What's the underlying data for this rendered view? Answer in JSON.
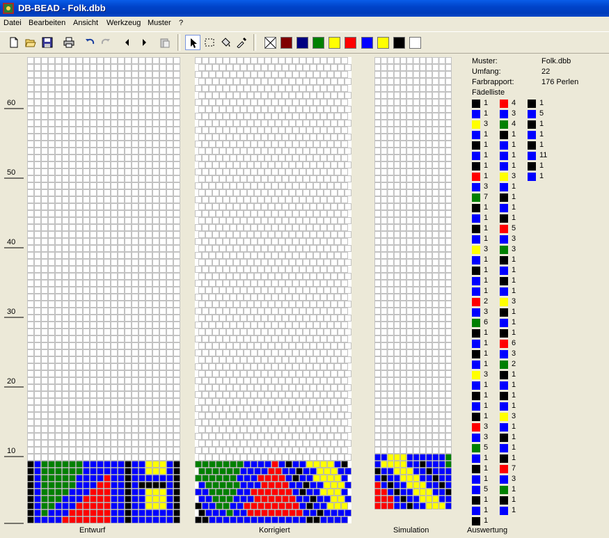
{
  "window": {
    "title": "DB-BEAD - Folk.dbb"
  },
  "menu": [
    "Datei",
    "Bearbeiten",
    "Ansicht",
    "Werkzeug",
    "Muster",
    "?"
  ],
  "palette": [
    "#800000",
    "#000080",
    "#008000",
    "#ffff00",
    "#ff0000",
    "#0000ff",
    "#ffff00",
    "#000000",
    "#ffffff"
  ],
  "ruler_labels": [
    "60",
    "50",
    "40",
    "30",
    "20",
    "10"
  ],
  "panels": {
    "entwurf": "Entwurf",
    "korrigiert": "Korrigiert",
    "simulation": "Simulation",
    "auswertung": "Auswertung"
  },
  "info": {
    "muster_label": "Muster:",
    "muster_value": "Folk.dbb",
    "umfang_label": "Umfang:",
    "umfang_value": "22",
    "farbrapport_label": "Farbrapport:",
    "farbrapport_value": "176 Perlen",
    "faedelliste_label": "Fädelliste"
  },
  "color_codes": {
    "K": "#000000",
    "B": "#0000ff",
    "Y": "#ffff00",
    "R": "#ff0000",
    "G": "#008000"
  },
  "faedelliste": [
    [
      [
        "K",
        1
      ],
      [
        "B",
        1
      ],
      [
        "Y",
        3
      ],
      [
        "B",
        1
      ],
      [
        "K",
        1
      ],
      [
        "B",
        1
      ],
      [
        "K",
        1
      ],
      [
        "R",
        1
      ],
      [
        "B",
        3
      ],
      [
        "G",
        7
      ],
      [
        "K",
        1
      ],
      [
        "B",
        1
      ],
      [
        "K",
        1
      ],
      [
        "B",
        1
      ],
      [
        "Y",
        3
      ],
      [
        "B",
        1
      ],
      [
        "K",
        1
      ],
      [
        "B",
        1
      ],
      [
        "B",
        1
      ],
      [
        "R",
        2
      ],
      [
        "B",
        3
      ],
      [
        "G",
        6
      ],
      [
        "K",
        1
      ],
      [
        "B",
        1
      ],
      [
        "K",
        1
      ],
      [
        "B",
        1
      ],
      [
        "Y",
        3
      ],
      [
        "B",
        1
      ],
      [
        "K",
        1
      ],
      [
        "B",
        1
      ],
      [
        "K",
        1
      ],
      [
        "R",
        3
      ],
      [
        "B",
        3
      ],
      [
        "G",
        5
      ],
      [
        "B",
        1
      ],
      [
        "K",
        1
      ],
      [
        "B",
        1
      ],
      [
        "B",
        5
      ],
      [
        "K",
        1
      ],
      [
        "B",
        1
      ],
      [
        "K",
        1
      ]
    ],
    [
      [
        "R",
        4
      ],
      [
        "B",
        3
      ],
      [
        "G",
        4
      ],
      [
        "K",
        1
      ],
      [
        "B",
        1
      ],
      [
        "B",
        1
      ],
      [
        "B",
        1
      ],
      [
        "Y",
        3
      ],
      [
        "B",
        1
      ],
      [
        "K",
        1
      ],
      [
        "B",
        1
      ],
      [
        "K",
        1
      ],
      [
        "R",
        5
      ],
      [
        "B",
        3
      ],
      [
        "G",
        3
      ],
      [
        "K",
        1
      ],
      [
        "B",
        1
      ],
      [
        "K",
        1
      ],
      [
        "B",
        1
      ],
      [
        "Y",
        3
      ],
      [
        "K",
        1
      ],
      [
        "B",
        1
      ],
      [
        "K",
        1
      ],
      [
        "R",
        6
      ],
      [
        "B",
        3
      ],
      [
        "G",
        2
      ],
      [
        "K",
        1
      ],
      [
        "B",
        1
      ],
      [
        "K",
        1
      ],
      [
        "B",
        1
      ],
      [
        "Y",
        3
      ],
      [
        "B",
        1
      ],
      [
        "K",
        1
      ],
      [
        "B",
        1
      ],
      [
        "K",
        1
      ],
      [
        "R",
        7
      ],
      [
        "B",
        3
      ],
      [
        "G",
        1
      ],
      [
        "K",
        1
      ],
      [
        "B",
        1
      ]
    ],
    [
      [
        "K",
        1
      ],
      [
        "B",
        5
      ],
      [
        "K",
        1
      ],
      [
        "B",
        1
      ],
      [
        "K",
        1
      ],
      [
        "B",
        11
      ],
      [
        "K",
        1
      ],
      [
        "B",
        1
      ]
    ]
  ],
  "pattern_rows": [
    "KBGGGGGGBBBBBBKBBYYYBK",
    "KBGGGGGGBBBBBBKBBYYYBK",
    "KBGGGGGBBBBRBBKBBBBBBK",
    "KBGGGGGBBBRRBBKBKKKKBK",
    "KBGGGGBBBRRRBBKBBYYYBK",
    "KBGGGBBBRRRRBBKBBYYYBK",
    "KBGGBBBRRRRRBBKBBYYYBK",
    "KBGBBBRRRRRRBBKBBBBBBK",
    "KBBBBRRRRRRRBBKBBBBBBK"
  ],
  "korr_rows": [
    "GGGGGGGBBBBRBKBBYYYYBK",
    "GGGGGGBBBBRRBBKBBYYYBB",
    "GGGGGGBBBRRRRBKBBYYYYBK",
    "BGGGGGBBBRRRRBBKBBYYYBB",
    "BBGGGGBBRRRRRRBKBBYYYBK",
    "BBGGGBBBRRRRRRBBKBBYYBB",
    "KBBGGBBRRRRRRRRBKBBYYYK",
    "KBBBGBBRRRRRRRRBBKBBBBB",
    "KKBBBBBBBBBBBBBBKKBBBBB"
  ],
  "sim_rows": [
    "BBYYYBBBBBBG",
    "BYYYYBBKBBBG",
    "KBBYYYBBKBBB",
    "BKBBYYYBBKBB",
    "RBKBBYYYBBKB",
    "RRBKBBYYYBBK",
    "RRRBKBBYYYBB",
    "RRRBBKBBYYYB"
  ]
}
